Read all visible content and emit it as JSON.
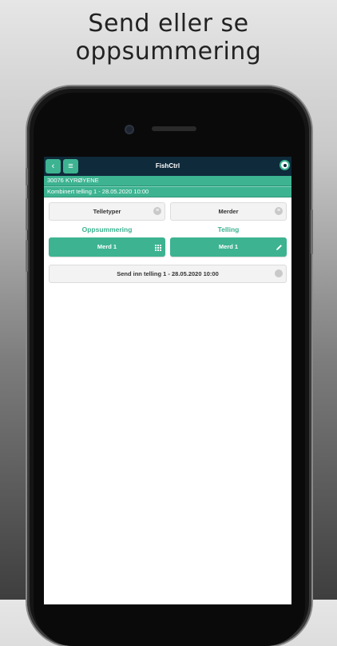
{
  "promo": {
    "headline": "Send eller se oppsummering"
  },
  "app": {
    "title": "FishCtrl",
    "back_icon": "‹",
    "menu_icon": "≡",
    "accent_color": "#3db391",
    "header_color": "#0f2a3b"
  },
  "info": {
    "location": "30076 KYRØYENE",
    "count": "Kombinert telling 1 - 28.05.2020 10:00"
  },
  "buttons": {
    "telletyper": "Telletyper",
    "merder": "Merder",
    "send": "Send inn telling 1 - 28.05.2020 10:00"
  },
  "sections": {
    "oppsummering": {
      "label": "Oppsummering",
      "merd": "Merd 1",
      "icon": "grid-icon"
    },
    "telling": {
      "label": "Telling",
      "merd": "Merd 1",
      "icon": "pencil-icon"
    }
  }
}
